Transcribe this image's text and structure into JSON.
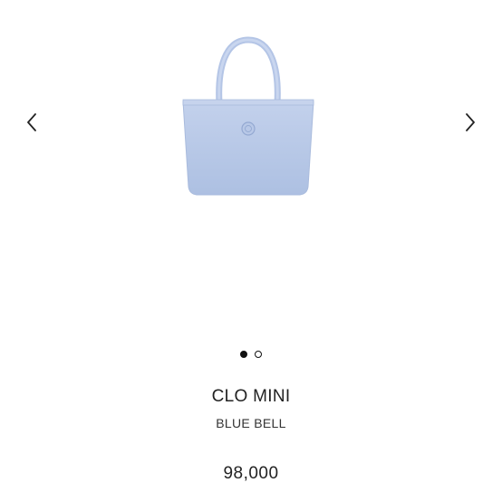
{
  "carousel": {
    "prev_icon": "chevron-left-icon",
    "next_icon": "chevron-right-icon",
    "slide_count": 2,
    "active_slide": 1
  },
  "product": {
    "name": "CLO MINI",
    "color": "BLUE BELL",
    "price": "98,000",
    "bag_color": "#b9c9e6"
  }
}
